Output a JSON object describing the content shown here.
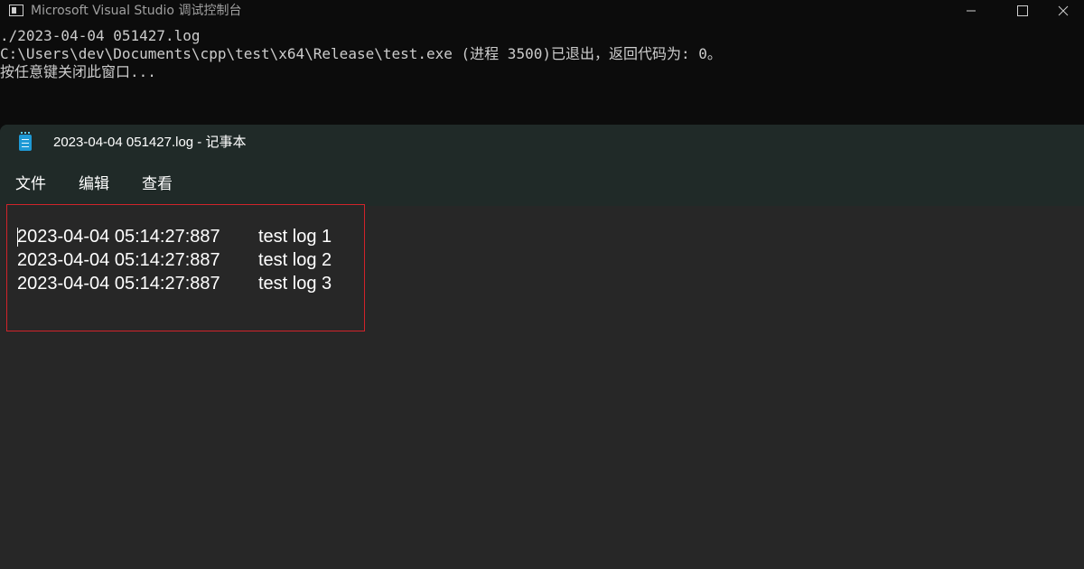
{
  "console": {
    "title": "Microsoft Visual Studio 调试控制台",
    "lines": [
      "./2023-04-04 051427.log",
      "C:\\Users\\dev\\Documents\\cpp\\test\\x64\\Release\\test.exe (进程 3500)已退出，返回代码为: 0。",
      "按任意键关闭此窗口..."
    ]
  },
  "notepad": {
    "title": "2023-04-04 051427.log - 记事本",
    "menu": {
      "file": "文件",
      "edit": "编辑",
      "view": "查看"
    },
    "rows": [
      {
        "timestamp": "2023-04-04 05:14:27:887",
        "message": "test log 1"
      },
      {
        "timestamp": "2023-04-04 05:14:27:887",
        "message": "test log 2"
      },
      {
        "timestamp": "2023-04-04 05:14:27:887",
        "message": "test log 3"
      }
    ]
  },
  "icons": {
    "console_app": "console-app-icon",
    "minimize": "minimize-icon",
    "maximize": "maximize-icon",
    "close": "close-icon",
    "notepad_app": "notepad-icon"
  },
  "colors": {
    "console_bg": "#0c0c0c",
    "console_text": "#cccccc",
    "notepad_chrome": "#202a28",
    "notepad_editor": "#272727",
    "highlight_border": "#d1232a"
  }
}
